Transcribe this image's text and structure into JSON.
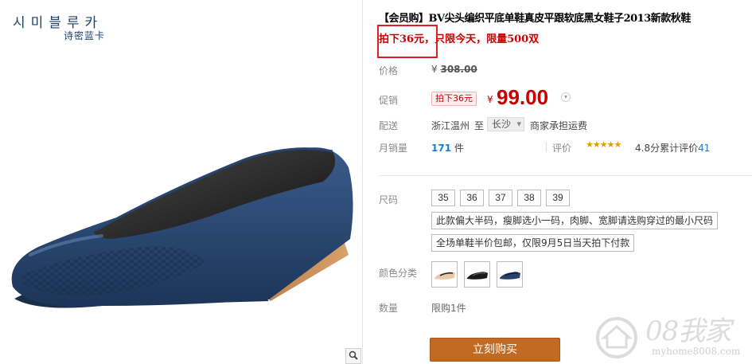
{
  "brand": {
    "korean": "시미블루카",
    "chinese": "诗密蓝卡"
  },
  "product": {
    "title": "【会员购】BV尖头编织平底单鞋真皮平跟软底黑女鞋子2013新款秋鞋",
    "promo_line": "拍下36元，只限今天，限量500双"
  },
  "price": {
    "label": "价格",
    "currency": "¥",
    "original": "308.00",
    "promo_label": "促销",
    "promo_badge": "拍下36元",
    "current": "99.00"
  },
  "shipping": {
    "label": "配送",
    "from": "浙江温州",
    "to_word": "至",
    "city": "长沙",
    "note": "商家承担运费"
  },
  "sales": {
    "label": "月销量",
    "count": "171",
    "unit": "件",
    "review_label": "评价",
    "stars": "★★★★★",
    "rating_text": "4.8分累计评价",
    "review_count": "41"
  },
  "sizes": {
    "label": "尺码",
    "options": [
      "35",
      "36",
      "37",
      "38",
      "39"
    ],
    "tip1": "此款偏大半码，瘦脚选小一码，肉脚、宽脚请选购穿过的最小尺码",
    "tip2": "全场单鞋半价包邮，仅限9月5日当天拍下付款"
  },
  "colors": {
    "label": "颜色分类",
    "swatches": [
      "beige",
      "black",
      "navy"
    ]
  },
  "quantity": {
    "label": "数量",
    "limit": "限购1件"
  },
  "buy_button": "立刻购买",
  "watermark": {
    "text": "08我家",
    "url": "myhome8008.com"
  },
  "icons": {
    "zoom": "magnifier-icon"
  },
  "theme": {
    "price_red": "#c40000",
    "buy_orange": "#c26a24",
    "link_blue": "#1a7ad1",
    "shoe_navy": "#24426b"
  }
}
